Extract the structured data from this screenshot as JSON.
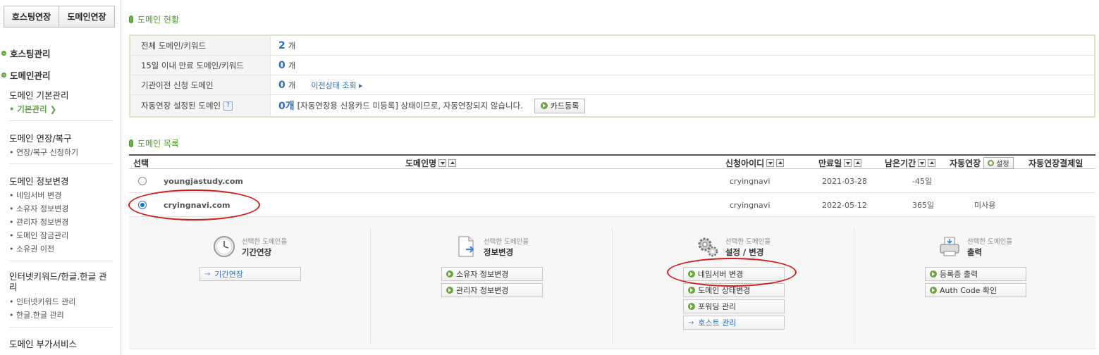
{
  "sidebar": {
    "top_buttons": [
      "호스팅연장",
      "도메인연장"
    ],
    "groups": [
      {
        "title": "호스팅관리"
      },
      {
        "title": "도메인관리"
      }
    ],
    "sections": {
      "basic": {
        "title": "도메인 기본관리",
        "items": [
          "• 기본관리 ❯"
        ]
      },
      "renew": {
        "title": "도메인 연장/복구",
        "items": [
          "• 연장/복구 신청하기"
        ]
      },
      "info": {
        "title": "도메인 정보변경",
        "items": [
          "• 네임서버 변경",
          "• 소유자 정보변경",
          "• 관리자 정보변경",
          "• 도메인 잠금관리",
          "• 소유권 이전"
        ]
      },
      "keyword": {
        "title": "인터넷키워드/한글.한글 관리",
        "items": [
          "• 인터넷키워드 관리",
          "• 한글.한글 관리"
        ]
      },
      "extra": {
        "title": "도메인 부가서비스"
      }
    }
  },
  "status": {
    "title": "도메인 현황",
    "rows": [
      {
        "label": "전체 도메인/키워드",
        "num": "2",
        "unit": "개"
      },
      {
        "label": "15일 이내 만료 도메인/키워드",
        "num": "0",
        "unit": "개"
      },
      {
        "label": "기관이전 신청 도메인",
        "num": "0",
        "unit": "개",
        "link": "이전상태 조회 ▸"
      },
      {
        "label": "자동연장 설정된 도메인",
        "help": "?",
        "num": "0개",
        "note": "[자동연장용 신용카드 미등록] 상태이므로, 자동연장되지 않습니다.",
        "button": "카드등록"
      }
    ]
  },
  "list": {
    "title": "도메인 목록",
    "headers": {
      "select": "선택",
      "domain": "도메인명",
      "applicant": "신청아이디",
      "expiry": "만료일",
      "remaining": "남은기간",
      "autorenew": "자동연장",
      "settings": "설정",
      "autopay": "자동연장결제일"
    },
    "rows": [
      {
        "domain": "youngjastudy.com",
        "applicant": "cryingnavi",
        "expiry": "2021-03-28",
        "remaining": "-45일",
        "autorenew": "",
        "selected": false
      },
      {
        "domain": "cryingnavi.com",
        "applicant": "cryingnavi",
        "expiry": "2022-05-12",
        "remaining": "365일",
        "autorenew": "미사용",
        "selected": true
      }
    ]
  },
  "actions": {
    "columns": [
      {
        "pre": "선택한 도메인을",
        "title": "기간연장",
        "icon": "clock-icon",
        "buttons": [
          {
            "label": "기간연장",
            "style": "arrow"
          }
        ]
      },
      {
        "pre": "선택한 도메인을",
        "title": "정보변경",
        "icon": "document-icon",
        "buttons": [
          {
            "label": "소유자 정보변경",
            "style": "dot"
          },
          {
            "label": "관리자 정보변경",
            "style": "dot"
          }
        ]
      },
      {
        "pre": "선택한 도메인을",
        "title": "설정 / 변경",
        "icon": "gears-icon",
        "buttons": [
          {
            "label": "네임서버 변경",
            "style": "dot"
          },
          {
            "label": "도메인 상태변경",
            "style": "dot"
          },
          {
            "label": "포워딩 관리",
            "style": "dot"
          },
          {
            "label": "호스트 관리",
            "style": "arrow"
          }
        ]
      },
      {
        "pre": "선택한 도메인을",
        "title": "출력",
        "icon": "printer-icon",
        "buttons": [
          {
            "label": "등록증 출력",
            "style": "dot"
          },
          {
            "label": "Auth Code 확인",
            "style": "dot"
          }
        ]
      }
    ]
  },
  "colors": {
    "accent_green": "#5ea83e",
    "link_blue": "#2a6dc4",
    "annotation_red": "#d21a1a"
  }
}
